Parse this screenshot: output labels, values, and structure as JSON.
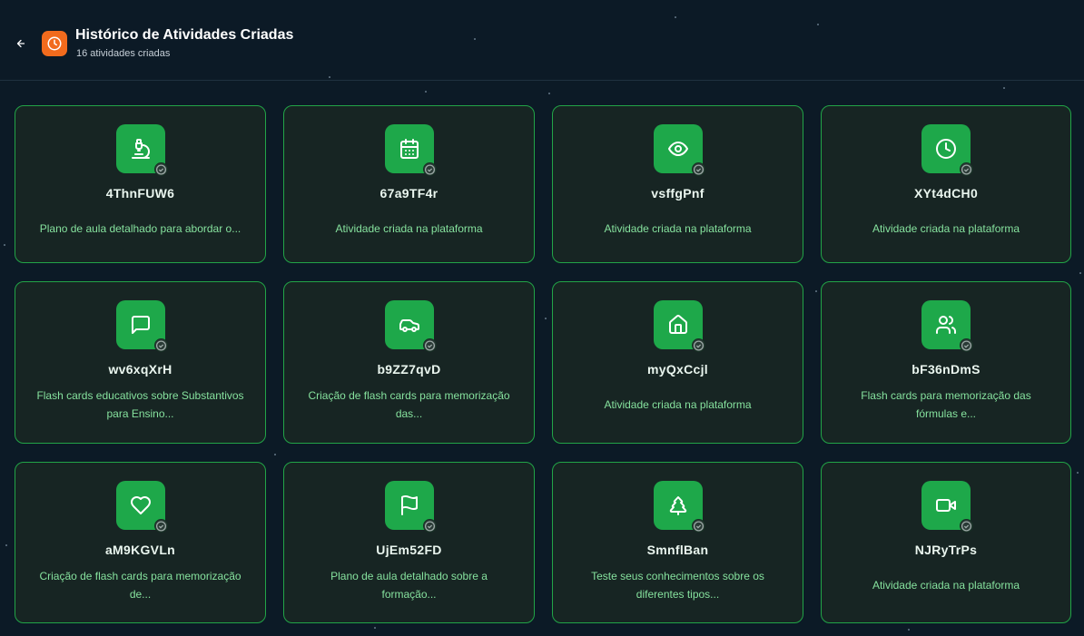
{
  "header": {
    "title": "Histórico de Atividades Criadas",
    "subtitle": "16 atividades criadas",
    "header_icon": "clock-icon",
    "back_icon": "arrow-left-icon"
  },
  "colors": {
    "accent_green": "#1ea84a",
    "card_border": "#22a447",
    "header_icon_bg": "#f26b1d",
    "description_text": "#86e29e"
  },
  "activities": [
    {
      "id": "4ThnFUW6",
      "description": "Plano de aula detalhado para abordar o...",
      "icon": "microscope-icon"
    },
    {
      "id": "67a9TF4r",
      "description": "Atividade criada na plataforma",
      "icon": "calendar-icon"
    },
    {
      "id": "vsffgPnf",
      "description": "Atividade criada na plataforma",
      "icon": "eye-icon"
    },
    {
      "id": "XYt4dCH0",
      "description": "Atividade criada na plataforma",
      "icon": "clock-icon"
    },
    {
      "id": "wv6xqXrH",
      "description": "Flash cards educativos sobre Substantivos para Ensino...",
      "icon": "message-icon"
    },
    {
      "id": "b9ZZ7qvD",
      "description": "Criação de flash cards para memorização das...",
      "icon": "car-icon"
    },
    {
      "id": "myQxCcjl",
      "description": "Atividade criada na plataforma",
      "icon": "home-icon"
    },
    {
      "id": "bF36nDmS",
      "description": "Flash cards para memorização das fórmulas e...",
      "icon": "users-icon"
    },
    {
      "id": "aM9KGVLn",
      "description": "Criação de flash cards para memorização de...",
      "icon": "heart-icon"
    },
    {
      "id": "UjEm52FD",
      "description": "Plano de aula detalhado sobre a formação...",
      "icon": "flag-icon"
    },
    {
      "id": "SmnflBan",
      "description": "Teste seus conhecimentos sobre os diferentes tipos...",
      "icon": "tree-icon"
    },
    {
      "id": "NJRyTrPs",
      "description": "Atividade criada na plataforma",
      "icon": "video-icon"
    }
  ]
}
